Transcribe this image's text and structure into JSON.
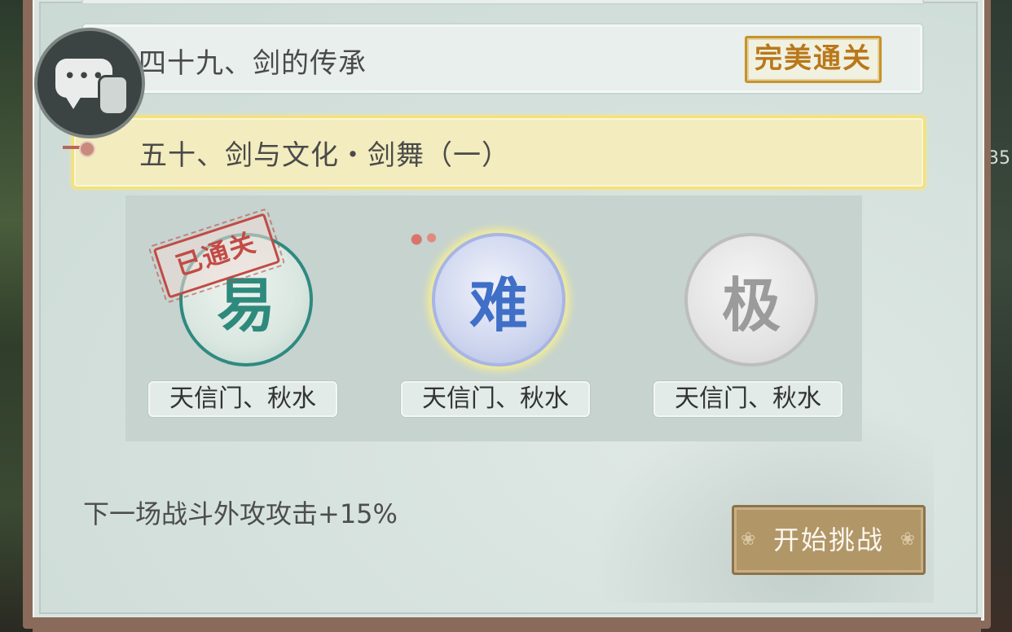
{
  "chapters": [
    {
      "title": "四十九、剑的传承",
      "stamp": "完美通关"
    },
    {
      "title": "五十、剑与文化・剑舞（一）"
    }
  ],
  "difficulties": [
    {
      "glyph": "易",
      "label": "天信门、秋水",
      "stamp": "已通关",
      "icon": "easy-orb"
    },
    {
      "glyph": "难",
      "label": "天信门、秋水",
      "icon": "hard-orb"
    },
    {
      "glyph": "极",
      "label": "天信门、秋水",
      "icon": "extreme-orb"
    }
  ],
  "buff_text": "下一场战斗外攻攻击+15%",
  "start_button": "开始挑战",
  "side_number": "35",
  "colors": {
    "accent": "#b19668",
    "highlight": "#f2ecbe",
    "stamp_red": "#c24a45",
    "stamp_gold": "#c8932a"
  }
}
